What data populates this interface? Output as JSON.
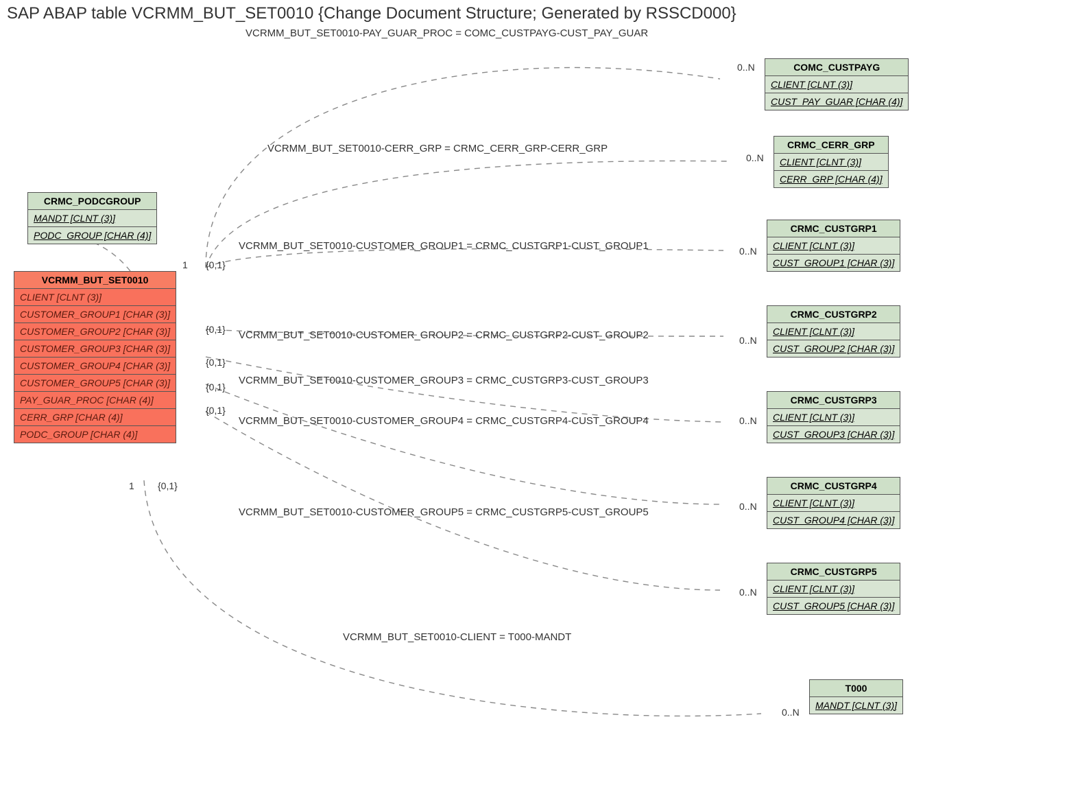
{
  "title": "SAP ABAP table VCRMM_BUT_SET0010 {Change Document Structure; Generated by RSSCD000}",
  "main_entity": {
    "name": "VCRMM_BUT_SET0010",
    "rows": [
      "CLIENT [CLNT (3)]",
      "CUSTOMER_GROUP1 [CHAR (3)]",
      "CUSTOMER_GROUP2 [CHAR (3)]",
      "CUSTOMER_GROUP3 [CHAR (3)]",
      "CUSTOMER_GROUP4 [CHAR (3)]",
      "CUSTOMER_GROUP5 [CHAR (3)]",
      "PAY_GUAR_PROC [CHAR (4)]",
      "CERR_GRP [CHAR (4)]",
      "PODC_GROUP [CHAR (4)]"
    ]
  },
  "podcgroup": {
    "name": "CRMC_PODCGROUP",
    "rows": [
      "MANDT [CLNT (3)]",
      "PODC_GROUP [CHAR (4)]"
    ]
  },
  "comc_custpayg": {
    "name": "COMC_CUSTPAYG",
    "rows": [
      "CLIENT [CLNT (3)]",
      "CUST_PAY_GUAR [CHAR (4)]"
    ]
  },
  "cerr_grp": {
    "name": "CRMC_CERR_GRP",
    "rows": [
      "CLIENT [CLNT (3)]",
      "CERR_GRP [CHAR (4)]"
    ]
  },
  "custgrp1": {
    "name": "CRMC_CUSTGRP1",
    "rows": [
      "CLIENT [CLNT (3)]",
      "CUST_GROUP1 [CHAR (3)]"
    ]
  },
  "custgrp2": {
    "name": "CRMC_CUSTGRP2",
    "rows": [
      "CLIENT [CLNT (3)]",
      "CUST_GROUP2 [CHAR (3)]"
    ]
  },
  "custgrp3": {
    "name": "CRMC_CUSTGRP3",
    "rows": [
      "CLIENT [CLNT (3)]",
      "CUST_GROUP3 [CHAR (3)]"
    ]
  },
  "custgrp4": {
    "name": "CRMC_CUSTGRP4",
    "rows": [
      "CLIENT [CLNT (3)]",
      "CUST_GROUP4 [CHAR (3)]"
    ]
  },
  "custgrp5": {
    "name": "CRMC_CUSTGRP5",
    "rows": [
      "CLIENT [CLNT (3)]",
      "CUST_GROUP5 [CHAR (3)]"
    ]
  },
  "t000": {
    "name": "T000",
    "rows": [
      "MANDT [CLNT (3)]"
    ]
  },
  "relations": {
    "r1": "VCRMM_BUT_SET0010-PAY_GUAR_PROC = COMC_CUSTPAYG-CUST_PAY_GUAR",
    "r2": "VCRMM_BUT_SET0010-CERR_GRP = CRMC_CERR_GRP-CERR_GRP",
    "r3": "VCRMM_BUT_SET0010-CUSTOMER_GROUP1 = CRMC_CUSTGRP1-CUST_GROUP1",
    "r4": "VCRMM_BUT_SET0010-CUSTOMER_GROUP2 = CRMC_CUSTGRP2-CUST_GROUP2",
    "r5": "VCRMM_BUT_SET0010-CUSTOMER_GROUP3 = CRMC_CUSTGRP3-CUST_GROUP3",
    "r6": "VCRMM_BUT_SET0010-CUSTOMER_GROUP4 = CRMC_CUSTGRP4-CUST_GROUP4",
    "r7": "VCRMM_BUT_SET0010-CUSTOMER_GROUP5 = CRMC_CUSTGRP5-CUST_GROUP5",
    "r8": "VCRMM_BUT_SET0010-CLIENT = T000-MANDT"
  },
  "card": {
    "c01": "{0,1}",
    "c1": "1",
    "cN": "0..N"
  }
}
